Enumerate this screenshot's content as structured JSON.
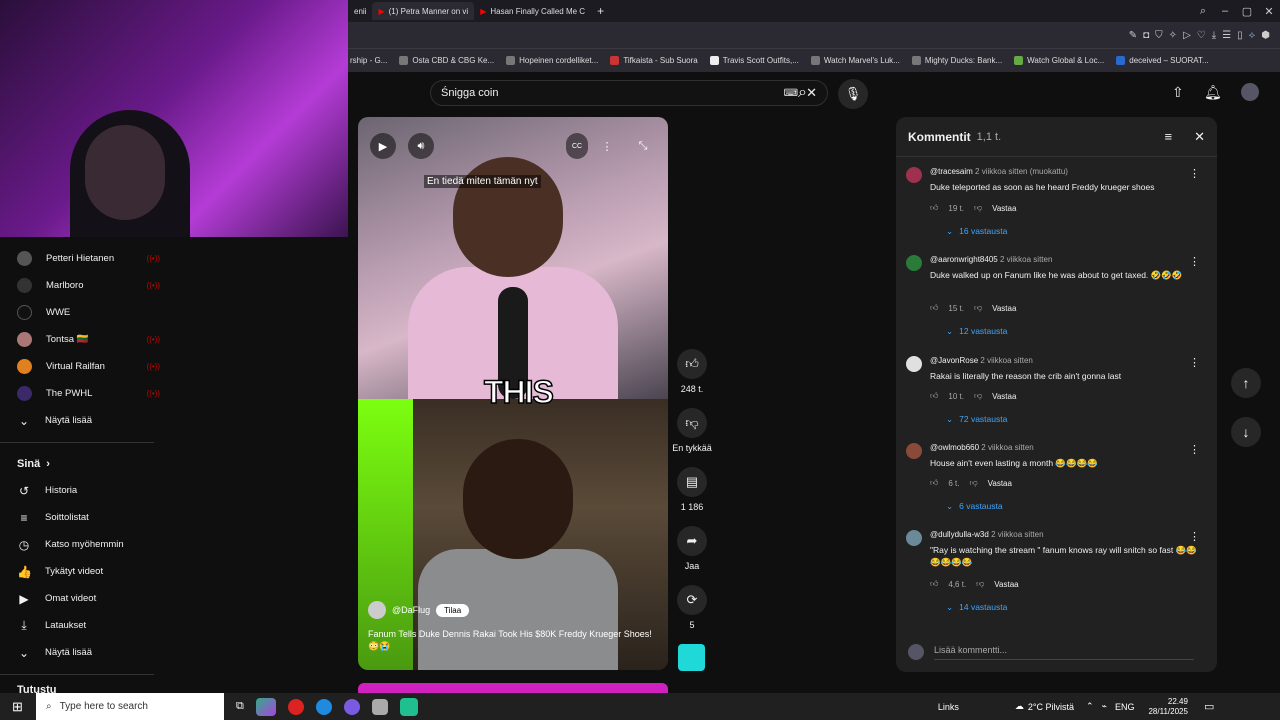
{
  "browser": {
    "tabs": [
      {
        "label": "enii",
        "active": false
      },
      {
        "label": "(1) Petra Manner on vi",
        "active": true
      },
      {
        "label": "Hasan Finally Called Me C",
        "active": false
      }
    ],
    "new_tab": "+"
  },
  "bookmarks": [
    "rship - G...",
    "Osta CBD & CBG Ke...",
    "Hopeinen cordelliket...",
    "Tifkaista - Sub Suora",
    "Travis Scott Outfits,...",
    "Watch Marvel's Luk...",
    "Mighty Ducks: Bank...",
    "Watch Global & Loc...",
    "deceived – SUORAT..."
  ],
  "sidebar": {
    "channels": [
      {
        "label": "Petteri Hietanen"
      },
      {
        "label": "Marlboro"
      },
      {
        "label": "WWE"
      },
      {
        "label": "Tontsa 🇱🇹"
      },
      {
        "label": "Virtual Railfan"
      },
      {
        "label": "The PWHL"
      }
    ],
    "show_more": "Näytä lisää",
    "you_section": "Sinä",
    "you_items": [
      {
        "label": "Historia",
        "icon": "history-icon"
      },
      {
        "label": "Soittolistat",
        "icon": "playlist-icon"
      },
      {
        "label": "Katso myöhemmin",
        "icon": "clock-icon"
      },
      {
        "label": "Tykätyt videot",
        "icon": "thumbs-up-icon"
      },
      {
        "label": "Omat videot",
        "icon": "video-icon"
      },
      {
        "label": "Lataukset",
        "icon": "download-icon"
      }
    ],
    "show_more_2": "Näytä lisää",
    "next_section": "Tutustu"
  },
  "search": {
    "value": "Śnigga coin"
  },
  "video": {
    "subtitle": "En tiedä miten tämän nyt",
    "caption": "THIS",
    "channel": "@DaFlug",
    "subscribe": "Tilaa",
    "title": "Fanum Tells Duke Dennis Rakai Took His $80K Freddy Krueger Shoes! 😳😭"
  },
  "actions": {
    "likes": "248 t.",
    "dislike": "En tykkää",
    "comments": "1 186",
    "share": "Jaa",
    "remix": "5"
  },
  "comments_panel": {
    "title": "Kommentit",
    "count": "1,1 t.",
    "add_placeholder": "Lisää kommentti...",
    "items": [
      {
        "user": "@tracesaim",
        "time": "2 viikkoa sitten (muokattu)",
        "text": "Duke teleported as soon as he heard Freddy krueger shoes",
        "likes": "19 t.",
        "reply": "Vastaa",
        "replies": "16 vastausta",
        "avatar": "#a03050"
      },
      {
        "user": "@aaronwright8405",
        "time": "2 viikkoa sitten",
        "text": "Duke walked up on Fanum like he was about to get taxed. 🤣🤣🤣",
        "likes": "15 t.",
        "reply": "Vastaa",
        "replies": "12 vastausta",
        "avatar": "#2a7a3a"
      },
      {
        "user": "@JavonRose",
        "time": "2 viikkoa sitten",
        "text": "Rakai is literally the reason the crib ain't gonna last",
        "likes": "10 t.",
        "reply": "Vastaa",
        "replies": "72 vastausta",
        "avatar": "#e0e0e0"
      },
      {
        "user": "@owlmob660",
        "time": "2 viikkoa sitten",
        "text": "House ain't even lasting a month 😂😂😂😂",
        "likes": "6 t.",
        "reply": "Vastaa",
        "replies": "6 vastausta",
        "avatar": "#8a4a3a"
      },
      {
        "user": "@dullydulla-w3d",
        "time": "2 viikkoa sitten",
        "text": "\"Ray is watching the stream \" fanum knows ray will snitch so fast 😂😂😂😂😂😂",
        "likes": "4,6 t.",
        "reply": "Vastaa",
        "replies": "14 vastausta",
        "avatar": "#6a8a9a"
      }
    ]
  },
  "taskbar": {
    "search_placeholder": "Type here to search",
    "links": "Links",
    "weather": "2°C Pilvistä",
    "lang": "ENG",
    "time": "22.49",
    "date": "28/11/2025"
  },
  "colors": {
    "accent": "#3ea6ff",
    "live": "#cc0000",
    "brand_pink": "#d020c0"
  }
}
